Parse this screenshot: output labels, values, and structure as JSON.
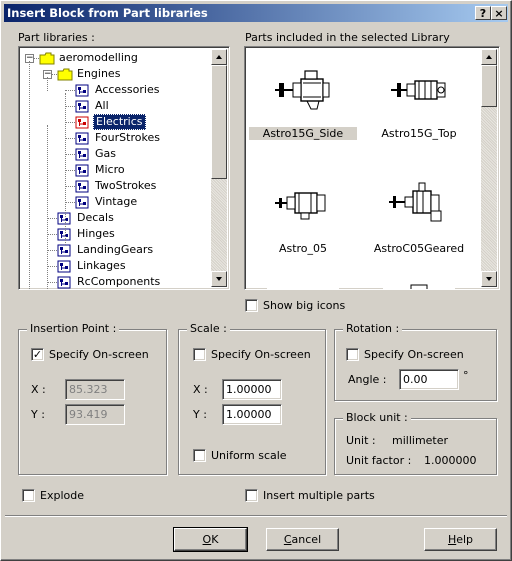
{
  "window": {
    "title": "Insert Block from Part libraries",
    "help_btn": "?",
    "close_btn": "×"
  },
  "libraries": {
    "label": "Part libraries :",
    "tree": [
      {
        "label": "aeromodelling",
        "icon": "folder-icon",
        "depth": 0
      },
      {
        "label": "Engines",
        "icon": "folder-icon",
        "depth": 1
      },
      {
        "label": "Accessories",
        "icon": "library-icon",
        "depth": 2
      },
      {
        "label": "All",
        "icon": "library-icon",
        "depth": 2
      },
      {
        "label": "Electrics",
        "icon": "library-icon-selected",
        "depth": 2,
        "selected": true
      },
      {
        "label": "FourStrokes",
        "icon": "library-icon",
        "depth": 2
      },
      {
        "label": "Gas",
        "icon": "library-icon",
        "depth": 2
      },
      {
        "label": "Micro",
        "icon": "library-icon",
        "depth": 2
      },
      {
        "label": "TwoStrokes",
        "icon": "library-icon",
        "depth": 2
      },
      {
        "label": "Vintage",
        "icon": "library-icon",
        "depth": 2
      },
      {
        "label": "Decals",
        "icon": "library-icon",
        "depth": 1
      },
      {
        "label": "Hinges",
        "icon": "library-icon",
        "depth": 1
      },
      {
        "label": "LandingGears",
        "icon": "library-icon",
        "depth": 1
      },
      {
        "label": "Linkages",
        "icon": "library-icon",
        "depth": 1
      },
      {
        "label": "RcComponents",
        "icon": "library-icon",
        "depth": 1
      }
    ],
    "scroll_position": 0.0
  },
  "parts": {
    "label": "Parts included in the selected Library",
    "items": [
      {
        "name": "Astro15G_Side",
        "selected": true
      },
      {
        "name": "Astro15G_Top",
        "selected": false
      },
      {
        "name": "Astro_05",
        "selected": false
      },
      {
        "name": "AstroC05Geared",
        "selected": false
      }
    ],
    "show_big_icons": {
      "label": "Show big icons",
      "checked": false
    }
  },
  "insertion_point": {
    "title": "Insertion Point :",
    "specify": {
      "label": "Specify On-screen",
      "checked": true
    },
    "x_label": "X :",
    "x_value": "85.323",
    "y_label": "Y :",
    "y_value": "93.419"
  },
  "scale": {
    "title": "Scale :",
    "specify": {
      "label": "Specify On-screen",
      "checked": false
    },
    "x_label": "X :",
    "x_value": "1.00000",
    "y_label": "Y :",
    "y_value": "1.00000",
    "uniform": {
      "label": "Uniform scale",
      "checked": false
    }
  },
  "rotation": {
    "title": "Rotation :",
    "specify": {
      "label": "Specify On-screen",
      "checked": false
    },
    "angle_label": "Angle :",
    "angle_value": "0.00",
    "degree_symbol": "°"
  },
  "block_unit": {
    "title": "Block unit :",
    "unit_label": "Unit :",
    "unit_value": "millimeter",
    "factor_label": "Unit factor :",
    "factor_value": "1.000000"
  },
  "options": {
    "explode": {
      "label": "Explode",
      "checked": false
    },
    "multiple": {
      "label": "Insert multiple parts",
      "checked": false
    }
  },
  "buttons": {
    "ok_u": "O",
    "ok_rest": "K",
    "cancel_u": "C",
    "cancel_rest": "ancel",
    "help_u": "H",
    "help_rest": "elp"
  }
}
